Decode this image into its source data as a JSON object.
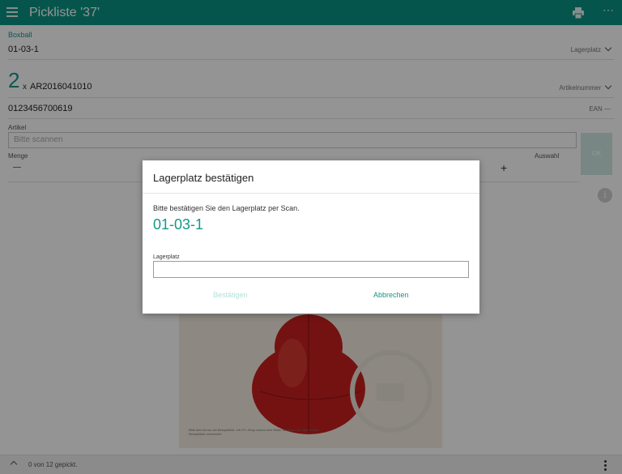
{
  "header": {
    "title": "Pickliste '37'",
    "menu_icon": "hamburger-menu-icon",
    "print_icon": "printer-icon",
    "more_icon": "more-horizontal-icon",
    "more_glyph": "⋯",
    "bg_color": "#0b9383"
  },
  "product": {
    "category": "Boxball"
  },
  "location_row": {
    "value": "01-03-1",
    "meta_label": "Lagerplatz"
  },
  "article_row": {
    "quantity": "2",
    "times": "x",
    "article_number": "AR2016041010",
    "meta_label": "Artikelnummer"
  },
  "ean_row": {
    "value": "0123456700619",
    "meta_label": "EAN",
    "dash": "—"
  },
  "artikel_field": {
    "label": "Artikel",
    "placeholder": "Bitte scannen"
  },
  "ok_button": {
    "label": "OK"
  },
  "menge": {
    "label": "Menge",
    "minus": "—",
    "plus": "+"
  },
  "auswahl": {
    "label": "Auswahl"
  },
  "info": {
    "glyph": "i"
  },
  "image_caption": "Bitte dies ist nur ein Beispielbild, mit JTL-Shop lassen sich Bilder anzeigen. Es wird nur ein Beispielbild verwendet.",
  "bottom_bar": {
    "status": "0 von 12 gepickt."
  },
  "dialog": {
    "title": "Lagerplatz bestätigen",
    "message": "Bitte bestätigen Sie den Lagerplatz per Scan.",
    "location": "01-03-1",
    "field_label": "Lagerplatz",
    "field_value": "",
    "confirm_label": "Bestätigen",
    "cancel_label": "Abbrechen"
  },
  "colors": {
    "accent": "#13978a",
    "disabled": "#b4e0d9"
  }
}
